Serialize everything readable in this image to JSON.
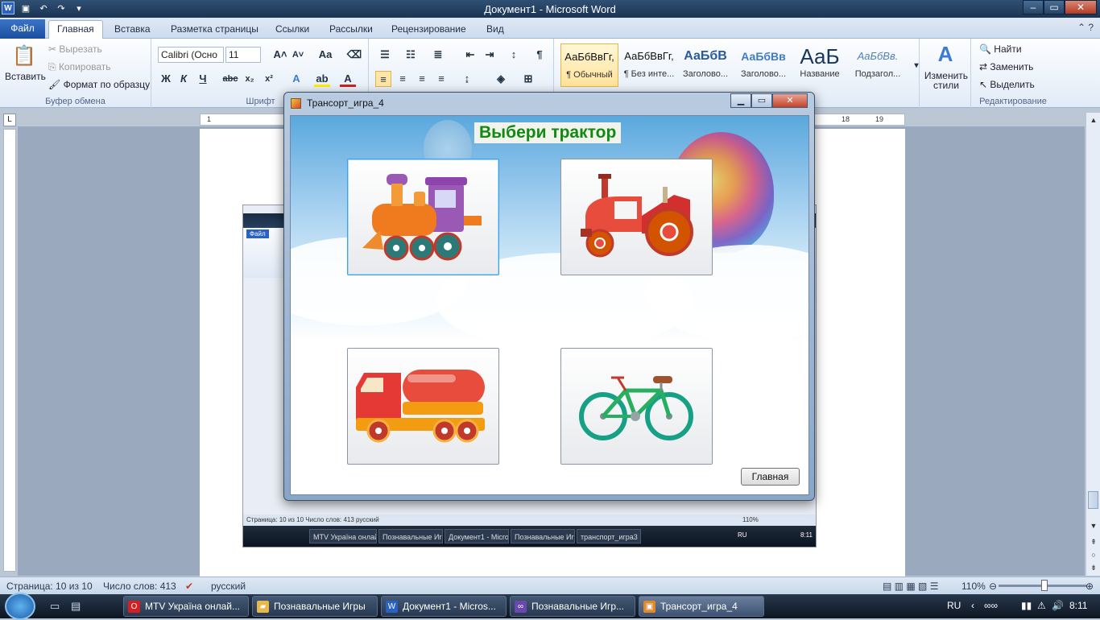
{
  "window": {
    "title": "Документ1 - Microsoft Word"
  },
  "ribbon": {
    "file_tab": "Файл",
    "tabs": [
      "Главная",
      "Вставка",
      "Разметка страницы",
      "Ссылки",
      "Рассылки",
      "Рецензирование",
      "Вид"
    ],
    "clipboard": {
      "paste": "Вставить",
      "cut": "Вырезать",
      "copy": "Копировать",
      "format_painter": "Формат по образцу",
      "label": "Буфер обмена"
    },
    "font": {
      "name": "Calibri (Осно",
      "size": "11",
      "label": "Шрифт"
    },
    "styles": [
      {
        "sample": "АаБбВвГг,",
        "name": "¶ Обычный"
      },
      {
        "sample": "АаБбВвГг,",
        "name": "¶ Без инте..."
      },
      {
        "sample": "АаБбВ",
        "name": "Заголово..."
      },
      {
        "sample": "АаБбВв",
        "name": "Заголово..."
      },
      {
        "sample": "АаБ",
        "name": "Название"
      },
      {
        "sample": "АаБбВв.",
        "name": "Подзагол..."
      }
    ],
    "change_styles": "Изменить стили",
    "editing": {
      "find": "Найти",
      "replace": "Заменить",
      "select": "Выделить",
      "label": "Редактирование"
    }
  },
  "ruler": {
    "marks": [
      "1",
      "18",
      "19"
    ]
  },
  "nested_screenshot": {
    "status_text": "Страница: 10 из 10   Число слов: 413   русский",
    "zoom": "110%",
    "tasks": [
      "MTV Україна онлай...",
      "Познавальные Игры",
      "Документ1 - Micros...",
      "Познавальные Игр...",
      "транспорт_игра3"
    ],
    "clock": "8:11",
    "lang": "RU",
    "file_tab": "Файл"
  },
  "dialog": {
    "title": "Трансорт_игра_4",
    "heading": "Выбери трактор",
    "cards": [
      {
        "name": "train"
      },
      {
        "name": "tractor"
      },
      {
        "name": "tanker-truck"
      },
      {
        "name": "bicycle"
      }
    ],
    "home_button": "Главная"
  },
  "statusbar": {
    "page": "Страница: 10 из 10",
    "words": "Число слов: 413",
    "language": "русский",
    "zoom": "110%"
  },
  "taskbar": {
    "items": [
      {
        "label": "MTV Україна онлай...",
        "icon": "opera-icon",
        "color": "#d42020"
      },
      {
        "label": "Познавальные Игры",
        "icon": "folder-icon",
        "color": "#e8b84a"
      },
      {
        "label": "Документ1 - Micros...",
        "icon": "word-icon",
        "color": "#2a62c4"
      },
      {
        "label": "Познавальные Игр...",
        "icon": "media-icon",
        "color": "#6a48b0"
      },
      {
        "label": "Трансорт_игра_4",
        "icon": "app-icon",
        "color": "#e0882a"
      }
    ],
    "lang": "RU",
    "clock": "8:11"
  }
}
